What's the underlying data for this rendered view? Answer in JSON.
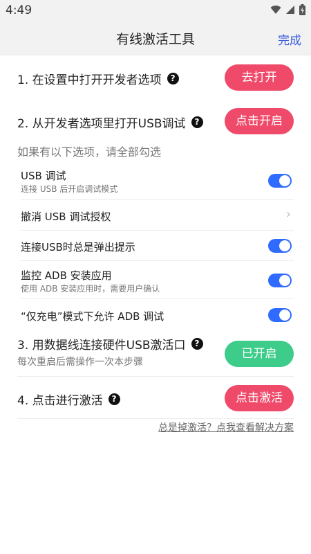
{
  "status_bar": {
    "time": "4:49",
    "icons": [
      "wifi-icon",
      "signal-icon",
      "battery-charging-icon"
    ]
  },
  "header": {
    "title": "有线激活工具",
    "done_label": "完成"
  },
  "steps": [
    {
      "label": "1. 在设置中打开开发者选项",
      "button": "去打开",
      "button_color": "#f04a6a"
    },
    {
      "label": "2. 从开发者选项里打开USB调试",
      "button": "点击开启",
      "button_color": "#f04a6a"
    },
    {
      "label": "3. 用数据线连接硬件USB激活口",
      "sub": "每次重启后需操作一次本步骤",
      "button": "已开启",
      "button_color": "#3dcc8a"
    },
    {
      "label": "4. 点击进行激活",
      "button": "点击激活",
      "button_color": "#f04a6a"
    }
  ],
  "options_hint": "如果有以下选项，请全部勾选",
  "options": [
    {
      "title": "USB 调试",
      "desc": "连接 USB 后开启调试模式",
      "type": "toggle",
      "on": true
    },
    {
      "title": "撤消 USB 调试授权",
      "type": "chevron"
    },
    {
      "title": "连接USB时总是弹出提示",
      "type": "toggle",
      "on": true
    },
    {
      "title": "监控 ADB 安装应用",
      "desc": "使用 ADB 安装应用时，需要用户确认",
      "type": "toggle",
      "on": true
    },
    {
      "title": "“仅充电”模式下允许 ADB 调试",
      "type": "toggle",
      "on": true
    }
  ],
  "footer_link": "总是掉激活？点我查看解决方案",
  "colors": {
    "accent_red": "#f04a6a",
    "accent_green": "#3dcc8a",
    "toggle_blue": "#2f6bff",
    "link_blue": "#3b5bdb"
  }
}
